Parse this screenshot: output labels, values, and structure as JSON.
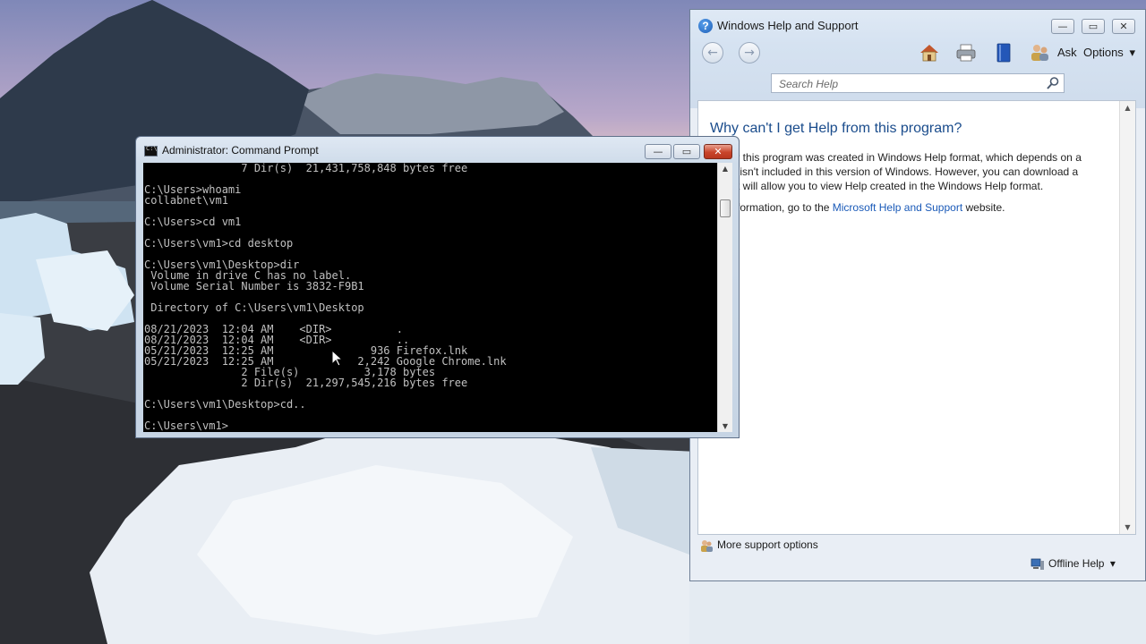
{
  "help_window": {
    "title": "Windows Help and Support",
    "title_icon": "help-question-icon",
    "caption": {
      "minimize": "▭",
      "maximize": "▭",
      "close": "✕"
    },
    "toolbar": {
      "back_icon": "back-arrow-icon",
      "forward_icon": "forward-arrow-icon",
      "home_icon": "home-icon",
      "print_icon": "printer-icon",
      "browse_icon": "book-icon",
      "ask_icon": "people-icon",
      "ask_label": "Ask",
      "options_label": "Options",
      "options_arrow": "▾"
    },
    "search": {
      "placeholder": "Search Help",
      "value": ""
    },
    "content": {
      "heading": "Why can't I get Help from this program?",
      "para1": "elp for this program was created in Windows Help format, which depends on a",
      "para1_line2": "e that isn't included in this version of Windows. However, you can download a",
      "para1_line3": "m that will allow you to view Help created in the Windows Help format.",
      "para2_prefix": "ore information, go to the ",
      "para2_link": "Microsoft Help and Support",
      "para2_suffix": " website."
    },
    "footer": {
      "support_label": "More support options",
      "offline_label": "Offline Help",
      "offline_arrow": "▾"
    }
  },
  "cmd_window": {
    "title": "Administrator: Command Prompt",
    "caption": {
      "minimize": "▁",
      "maximize": "▭",
      "close": "✕"
    },
    "console_lines": [
      "               7 Dir(s)  21,431,758,848 bytes free",
      "",
      "C:\\Users>whoami",
      "collabnet\\vm1",
      "",
      "C:\\Users>cd vm1",
      "",
      "C:\\Users\\vm1>cd desktop",
      "",
      "C:\\Users\\vm1\\Desktop>dir",
      " Volume in drive C has no label.",
      " Volume Serial Number is 3832-F9B1",
      "",
      " Directory of C:\\Users\\vm1\\Desktop",
      "",
      "08/21/2023  12:04 AM    <DIR>          .",
      "08/21/2023  12:04 AM    <DIR>          ..",
      "05/21/2023  12:25 AM               936 Firefox.lnk",
      "05/21/2023  12:25 AM             2,242 Google Chrome.lnk",
      "               2 File(s)          3,178 bytes",
      "               2 Dir(s)  21,297,545,216 bytes free",
      "",
      "C:\\Users\\vm1\\Desktop>cd..",
      "",
      "C:\\Users\\vm1>"
    ]
  }
}
